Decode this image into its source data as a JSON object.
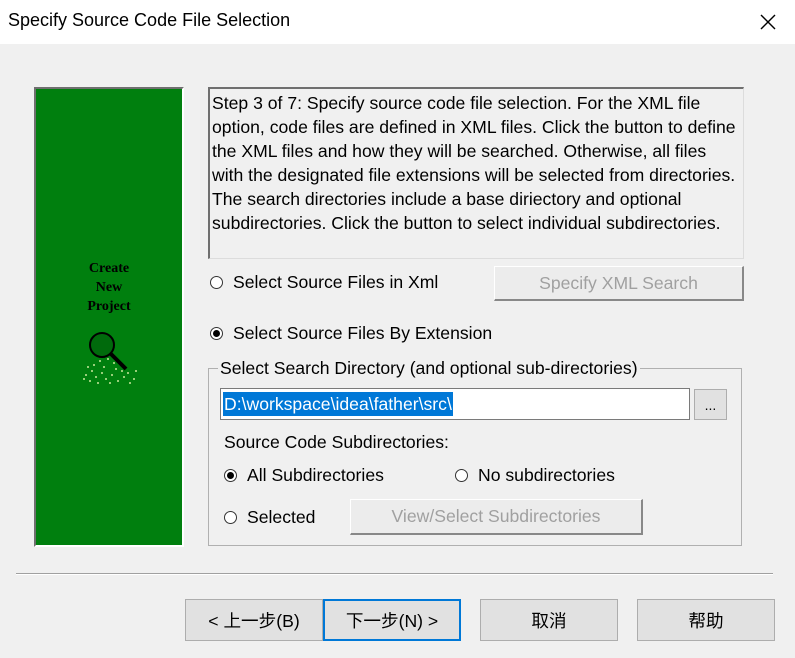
{
  "window": {
    "title": "Specify Source Code File Selection",
    "close_icon": "close-icon"
  },
  "banner": {
    "line1": "Create",
    "line2": "New",
    "line3": "Project",
    "logo_icon": "magnifier-icon",
    "background": "#007f0e"
  },
  "description": "Step 3 of 7: Specify source code file selection. For the XML file option, code files are defined in XML files. Click the button to define the XML files and how they will be searched. Otherwise, all files with the designated file extensions will be selected from directories. The search directories include a base diriectory and optional subdirectories. Click the button to select individual subdirectories.",
  "options": {
    "xml_label": "Select Source Files in Xml",
    "xml_checked": false,
    "specify_xml_button": "Specify XML Search",
    "extension_label": "Select Source Files By Extension",
    "extension_checked": true
  },
  "search_group": {
    "legend": "Select Search Directory (and optional sub-directories)",
    "path_value": "D:\\workspace\\idea\\father\\src\\",
    "browse_button": "...",
    "subdir_heading": "Source Code Subdirectories:",
    "all_subdirs_label": "All Subdirectories",
    "all_subdirs_checked": true,
    "no_subdirs_label": "No subdirectories",
    "no_subdirs_checked": false,
    "selected_label": "Selected",
    "selected_checked": false,
    "view_select_button": "View/Select Subdirectories"
  },
  "footer": {
    "back_button": "< 上一步(B)",
    "next_button": "下一步(N) >",
    "cancel_button": "取消",
    "help_button": "帮助"
  },
  "colors": {
    "accent": "#0078d7",
    "banner_green": "#007f0e"
  }
}
